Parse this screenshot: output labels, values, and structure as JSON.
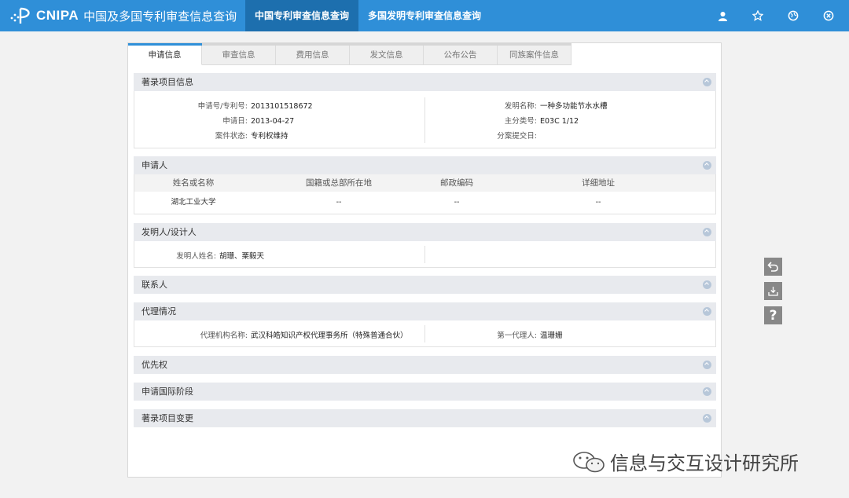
{
  "header": {
    "logo_text": "CNIPA",
    "logo_subtitle": "中国及多国专利审查信息查询",
    "tabs": [
      {
        "label": "中国专利审查信息查询"
      },
      {
        "label": "多国发明专利审查信息查询"
      }
    ],
    "icons": [
      "user-icon",
      "star-icon",
      "globe-icon",
      "close-circle-icon"
    ]
  },
  "tabs": [
    {
      "label": "申请信息"
    },
    {
      "label": "审查信息"
    },
    {
      "label": "费用信息"
    },
    {
      "label": "发文信息"
    },
    {
      "label": "公布公告"
    },
    {
      "label": "同族案件信息"
    }
  ],
  "bibliographic": {
    "title": "著录项目信息",
    "app_no_label": "申请号/专利号:",
    "app_no": "2013101518672",
    "app_date_label": "申请日:",
    "app_date": "2013-04-27",
    "status_label": "案件状态:",
    "status": "专利权维持",
    "invention_label": "发明名称:",
    "invention": "一种多功能节水水槽",
    "class_label": "主分类号:",
    "class": "E03C 1/12",
    "divisional_label": "分案提交日:",
    "divisional": ""
  },
  "applicant": {
    "title": "申请人",
    "columns": [
      "姓名或名称",
      "国籍或总部所在地",
      "邮政编码",
      "详细地址"
    ],
    "rows": [
      [
        "湖北工业大学",
        "--",
        "--",
        "--"
      ]
    ]
  },
  "inventor": {
    "title": "发明人/设计人",
    "name_label": "发明人姓名:",
    "names": "胡珊、栗毅天"
  },
  "contact": {
    "title": "联系人"
  },
  "agency": {
    "title": "代理情况",
    "org_label": "代理机构名称:",
    "org": "武汉科皓知识产权代理事务所（特殊普通合伙）",
    "agent_label": "第一代理人:",
    "agent": "温珊姗"
  },
  "priority": {
    "title": "优先权"
  },
  "international": {
    "title": "申请国际阶段"
  },
  "changes": {
    "title": "著录项目变更"
  },
  "watermark": {
    "text": "信息与交互设计研究所"
  }
}
